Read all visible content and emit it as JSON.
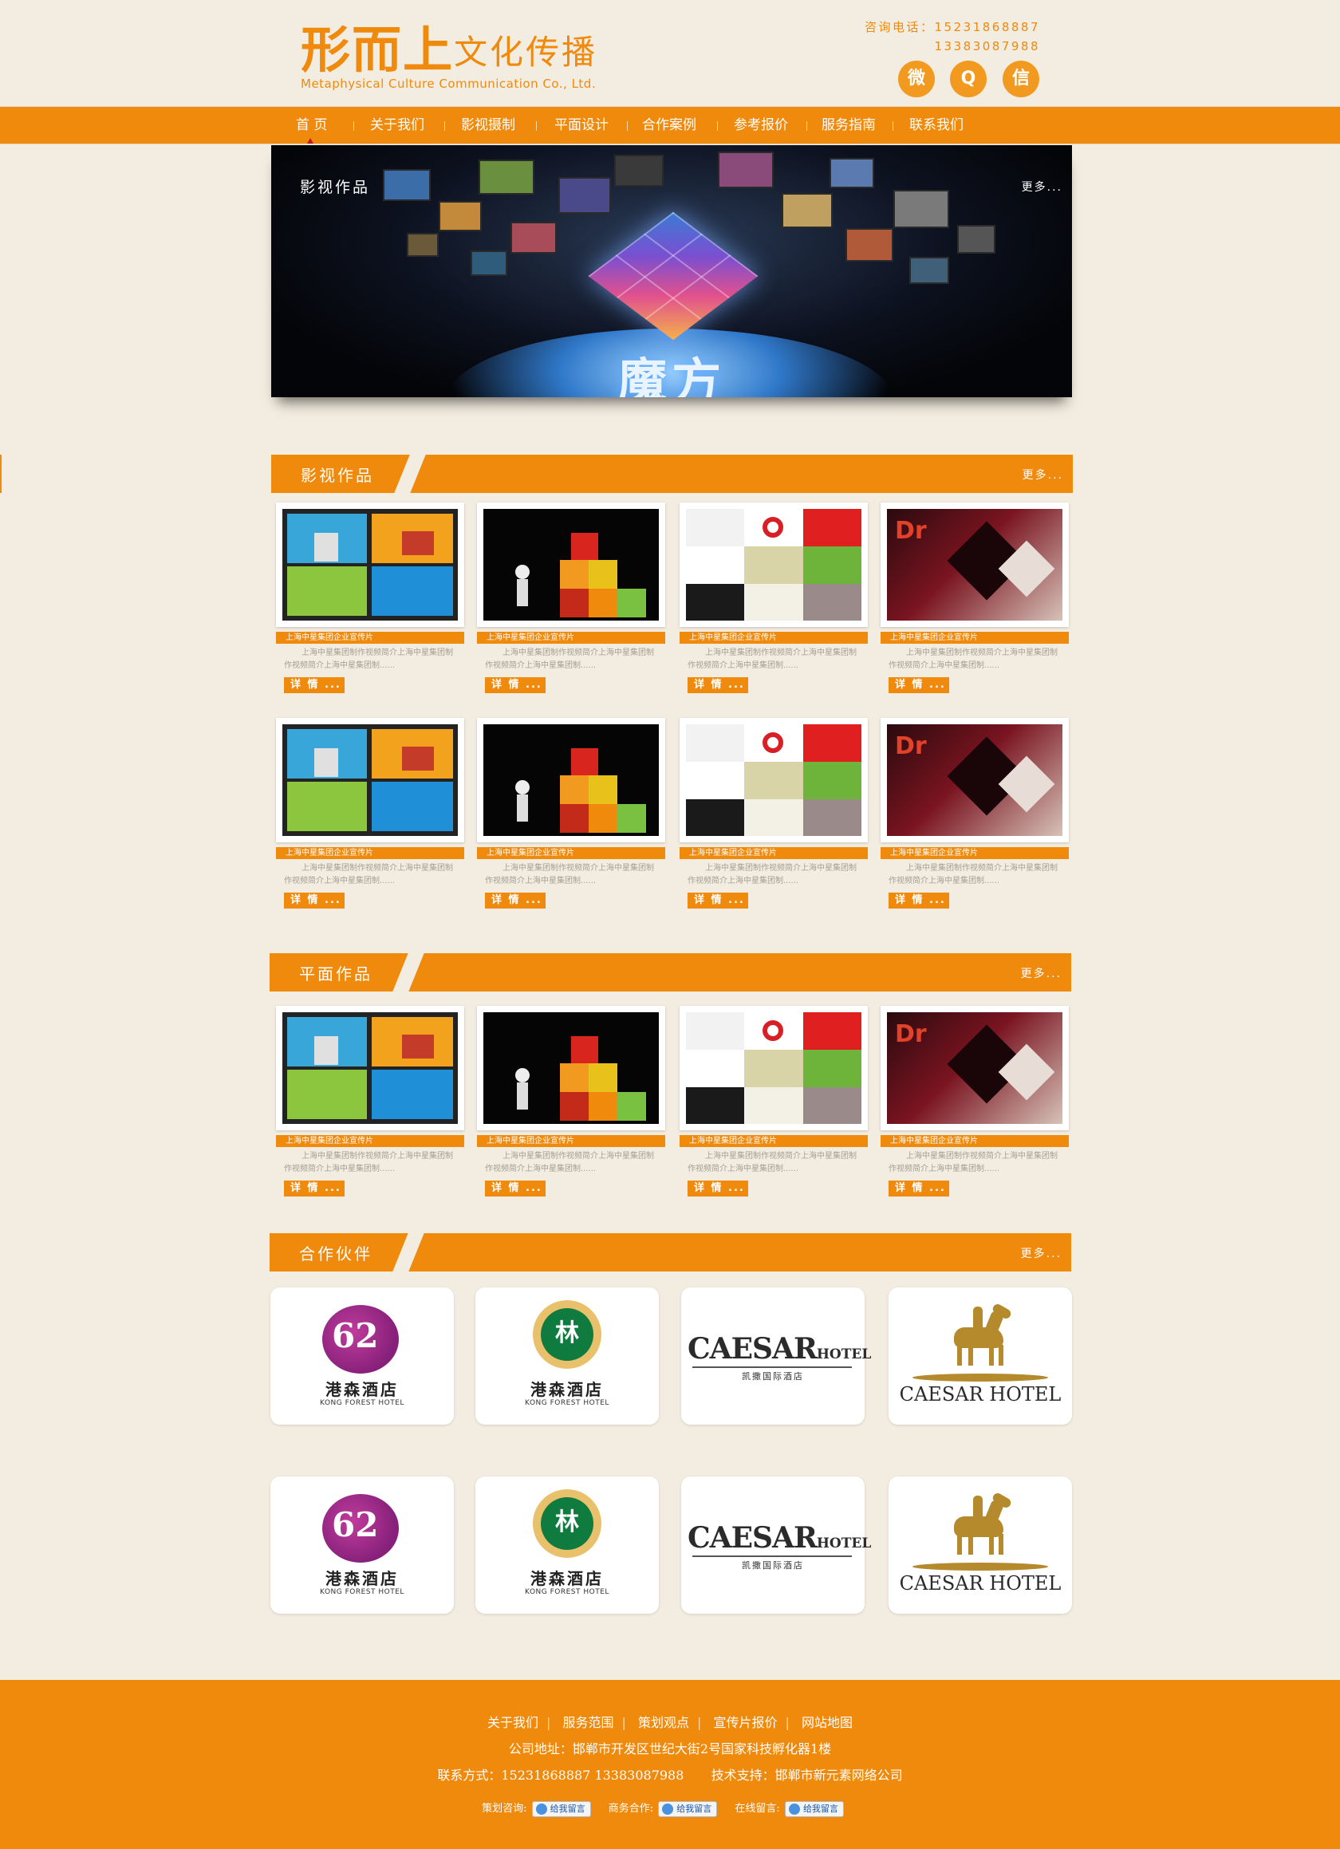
{
  "header": {
    "logo_bold": "形而上",
    "logo_thin": "文化传播",
    "logo_sub": "Metaphysical Culture Communication Co., Ltd.",
    "contact_label": "咨询电话：15231868887",
    "contact_phone2": "13383087988",
    "socials": [
      {
        "icon": "weibo-icon",
        "glyph": "微"
      },
      {
        "icon": "qq-icon",
        "glyph": "Q"
      },
      {
        "icon": "wechat-icon",
        "glyph": "信"
      }
    ]
  },
  "nav": {
    "items": [
      "首 页",
      "关于我们",
      "影视摄制",
      "平面设计",
      "合作案例",
      "参考报价",
      "服务指南",
      "联系我们"
    ],
    "active_index": 0
  },
  "banner": {
    "title": "影视作品",
    "more": "更多...",
    "logo_text": "魔方"
  },
  "sections": {
    "film": {
      "title": "影视作品",
      "more": "更多..."
    },
    "graphic": {
      "title": "平面作品",
      "more": "更多..."
    },
    "partners": {
      "title": "合作伙伴",
      "more": "更多..."
    }
  },
  "card": {
    "caption": "上海中星集团企业宣传片",
    "desc": "上海中星集团制作视频简介上海中星集团制作视频简介上海中星集团制......",
    "button": "详 情 ..."
  },
  "partners": [
    {
      "type": "kong",
      "cn": "港森酒店",
      "en": "KONG FOREST HOTEL"
    },
    {
      "type": "forest",
      "cn": "港森酒店",
      "en": "KONG FOREST HOTEL"
    },
    {
      "type": "caesar",
      "en": "CAESAR",
      "hotel": "HOTEL",
      "cn": "凯撒国际酒店"
    },
    {
      "type": "horse",
      "en": "CAESAR HOTEL"
    }
  ],
  "footer": {
    "links": [
      "关于我们",
      "服务范围",
      "策划观点",
      "宣传片报价",
      "网站地图"
    ],
    "address": "公司地址：邯郸市开发区世纪大街2号国家科技孵化器1楼",
    "contact": "联系方式：15231868887  13383087988",
    "support": "技术支持：邯郸市新元素网络公司",
    "chat": [
      {
        "label": "策划咨询:",
        "button": "给我留言"
      },
      {
        "label": "商务合作:",
        "button": "给我留言"
      },
      {
        "label": "在线留言:",
        "button": "给我留言"
      }
    ]
  },
  "colors": {
    "accent": "#f08a0c",
    "background": "#f3ece0"
  }
}
